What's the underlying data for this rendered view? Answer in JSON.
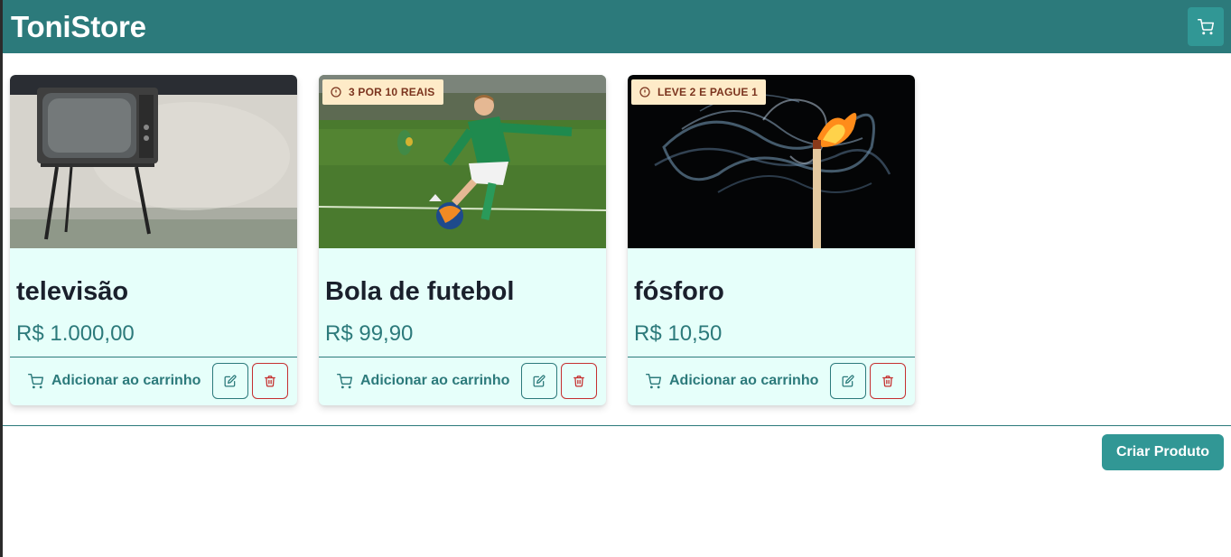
{
  "header": {
    "brand": "ToniStore",
    "cart_icon": "cart-icon"
  },
  "products": [
    {
      "image": "television-photo",
      "badge": null,
      "title": "televisão",
      "price": "R$ 1.000,00",
      "add_label": "Adicionar ao carrinho"
    },
    {
      "image": "soccer-kid-photo",
      "badge": "3 POR 10 REAIS",
      "title": "Bola de futebol",
      "price": "R$ 99,90",
      "add_label": "Adicionar ao carrinho"
    },
    {
      "image": "match-smoke-photo",
      "badge": "LEVE 2 E PAGUE 1",
      "title": "fósforo",
      "price": "R$ 10,50",
      "add_label": "Adicionar ao carrinho"
    }
  ],
  "footer": {
    "create_label": "Criar Produto"
  },
  "colors": {
    "header_bg": "#2c7a7b",
    "accent": "#319795",
    "card_bg": "#e6fffa",
    "danger": "#c53030",
    "badge_bg": "#feebc8"
  }
}
